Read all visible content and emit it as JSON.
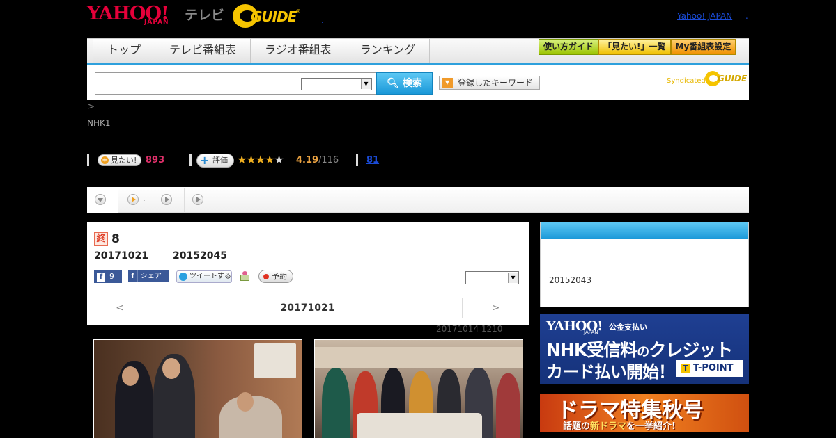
{
  "header": {
    "logo_yahoo": "YAHOO!",
    "logo_japan": "JAPAN",
    "logo_tv": "テレビ",
    "gguide_text": "GUIDE",
    "gguide_reg": "®",
    "top_dot": ".",
    "yahoo_japan_link": "Yahoo! JAPAN",
    "yj_dot": "."
  },
  "nav": {
    "tabs": [
      {
        "label": "トップ"
      },
      {
        "label": "テレビ番組表"
      },
      {
        "label": "ラジオ番組表"
      },
      {
        "label": "ランキング"
      }
    ],
    "buttons": [
      {
        "label": "使い方ガイド"
      },
      {
        "label": "「見たい!」一覧"
      },
      {
        "label": "My番組表設定"
      }
    ]
  },
  "search": {
    "value": "",
    "placeholder": "",
    "select_value": "",
    "search_label": "検索",
    "keywords_label": "登録したキーワード",
    "syndicated": "Syndicated",
    "synd_logo_text": "GUIDE"
  },
  "breadcrumb": ">",
  "channel": "NHK1",
  "stats": {
    "want_label": "見たい!",
    "want_count": "893",
    "rate_label": "評価",
    "rating": 4.19,
    "rating_text": "4.19",
    "rating_count": "/116",
    "link_count": "81"
  },
  "tabs_row": {
    "tab2_text": "."
  },
  "program": {
    "end_badge": "終",
    "episode": "8",
    "date": "20171021",
    "time": "20152045",
    "fb_like_count": "9",
    "fb_share_label": "シェア",
    "tweet_label": "ツイートする",
    "reserve_label": "予約",
    "nav_prev": "<",
    "nav_date": "20171021",
    "nav_next": ">",
    "air_info": "20171014  1210"
  },
  "side": {
    "time": "20152043"
  },
  "ad1": {
    "yahoo": "YAHOO!",
    "japan": "JAPAN",
    "tag": "公金支払い",
    "line1_a": "NHK受信料",
    "line1_b": "の",
    "line1_c": "クレジット",
    "line2": "カード払い開始！",
    "tpoint_t": "T",
    "tpoint_label": "T-POINT"
  },
  "ad2": {
    "line1": "ドラマ特集秋号",
    "line2_a": "話題の",
    "line2_b": "新ドラマ",
    "line2_c": "を一挙紹介!"
  },
  "colors": {
    "yahoo_red": "#e6003a",
    "gguide_yellow": "#f5c400",
    "nav_blue": "#2ea0dc",
    "pink_count": "#e0306a"
  }
}
